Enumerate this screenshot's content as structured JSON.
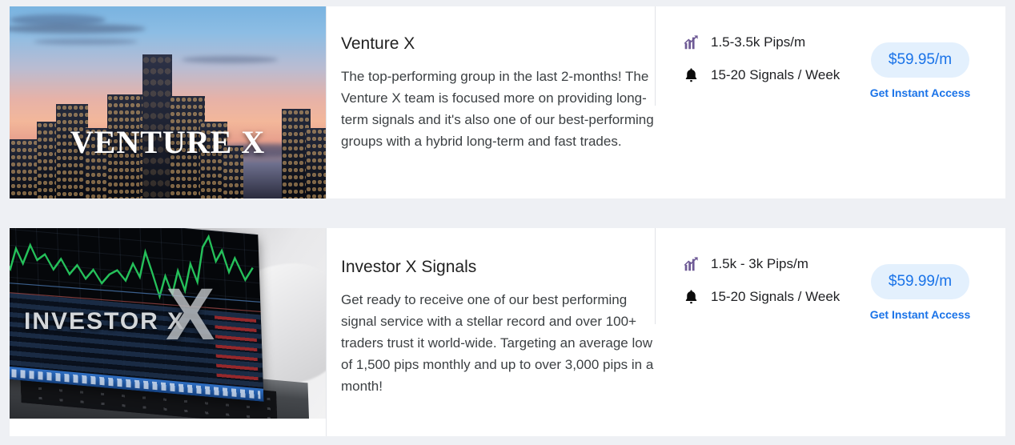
{
  "page": {
    "background_color": "#eef0f4",
    "accent_color": "#1a73e8",
    "badge_background_color": "#e3f0fd"
  },
  "cards": [
    {
      "id": "venture-x",
      "image": {
        "caption": "VENTURE X",
        "alt": "City skyline at sunset with high-rise towers"
      },
      "title": "Venture X",
      "description": "The top-performing group in the last 2-months! The Venture X team is focused more on providing long-term signals and it's also one of our best-performing groups with a hybrid long-term and fast trades.",
      "stats": [
        {
          "icon": "bar-chart-trend-icon",
          "label": "1.5-3.5k Pips/m"
        },
        {
          "icon": "bell-icon",
          "label": "15-20 Signals / Week"
        }
      ],
      "price": "$59.95/m",
      "cta": "Get Instant Access"
    },
    {
      "id": "investor-x-signals",
      "image": {
        "caption": "INVESTOR X",
        "alt": "Laptop displaying a green trading chart on a desk"
      },
      "title": "Investor X Signals",
      "description": "Get ready to receive one of our best performing signal service with a stellar record and over 100+ traders trust it world-wide. Targeting an average low of 1,500 pips monthly and up to over 3,000 pips in a month!",
      "stats": [
        {
          "icon": "bar-chart-trend-icon",
          "label": "1.5k - 3k Pips/m"
        },
        {
          "icon": "bell-icon",
          "label": "15-20 Signals / Week"
        }
      ],
      "price": "$59.99/m",
      "cta": "Get Instant Access"
    }
  ]
}
